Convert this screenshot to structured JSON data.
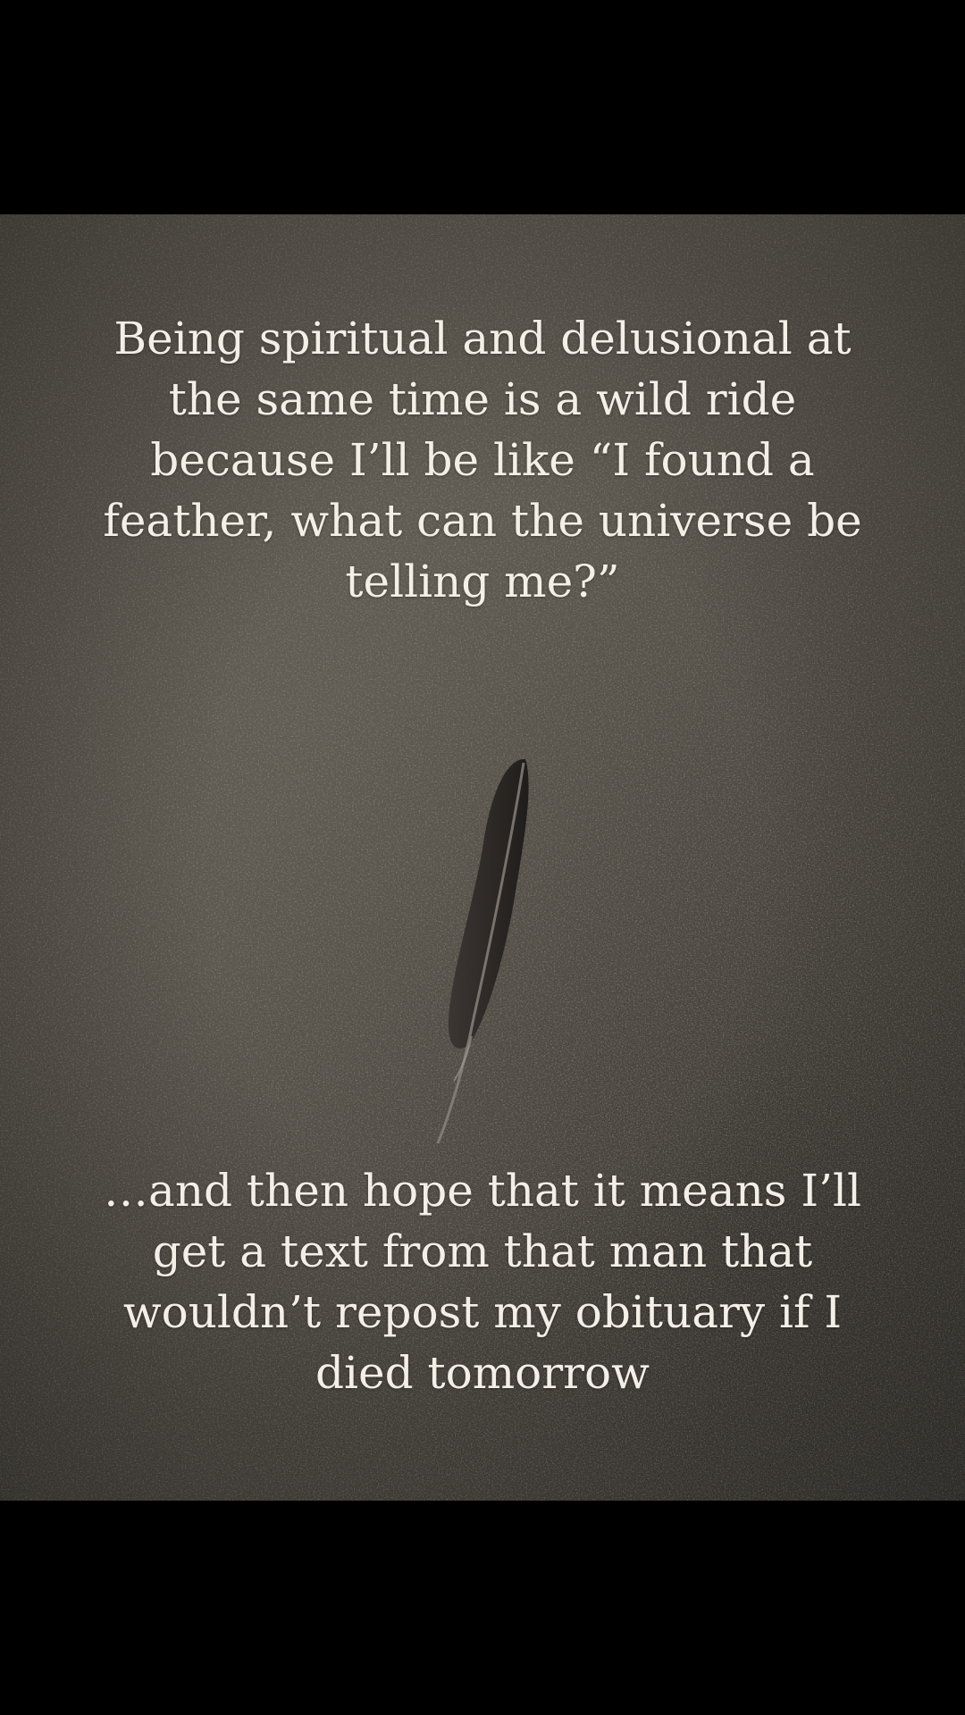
{
  "image": {
    "caption_top": "Being spiritual and delusional at the same time is a wild ride because I’ll be like “I found a feather, what can the universe be telling me?”",
    "caption_bottom": "…and then hope that it means I’ll get a text from that man that wouldn’t repost my obituary if I died tomorrow"
  },
  "colors": {
    "background_bars": "#000000",
    "concrete": "#534e46",
    "text": "#f3efe6",
    "feather": "#2a2624"
  }
}
